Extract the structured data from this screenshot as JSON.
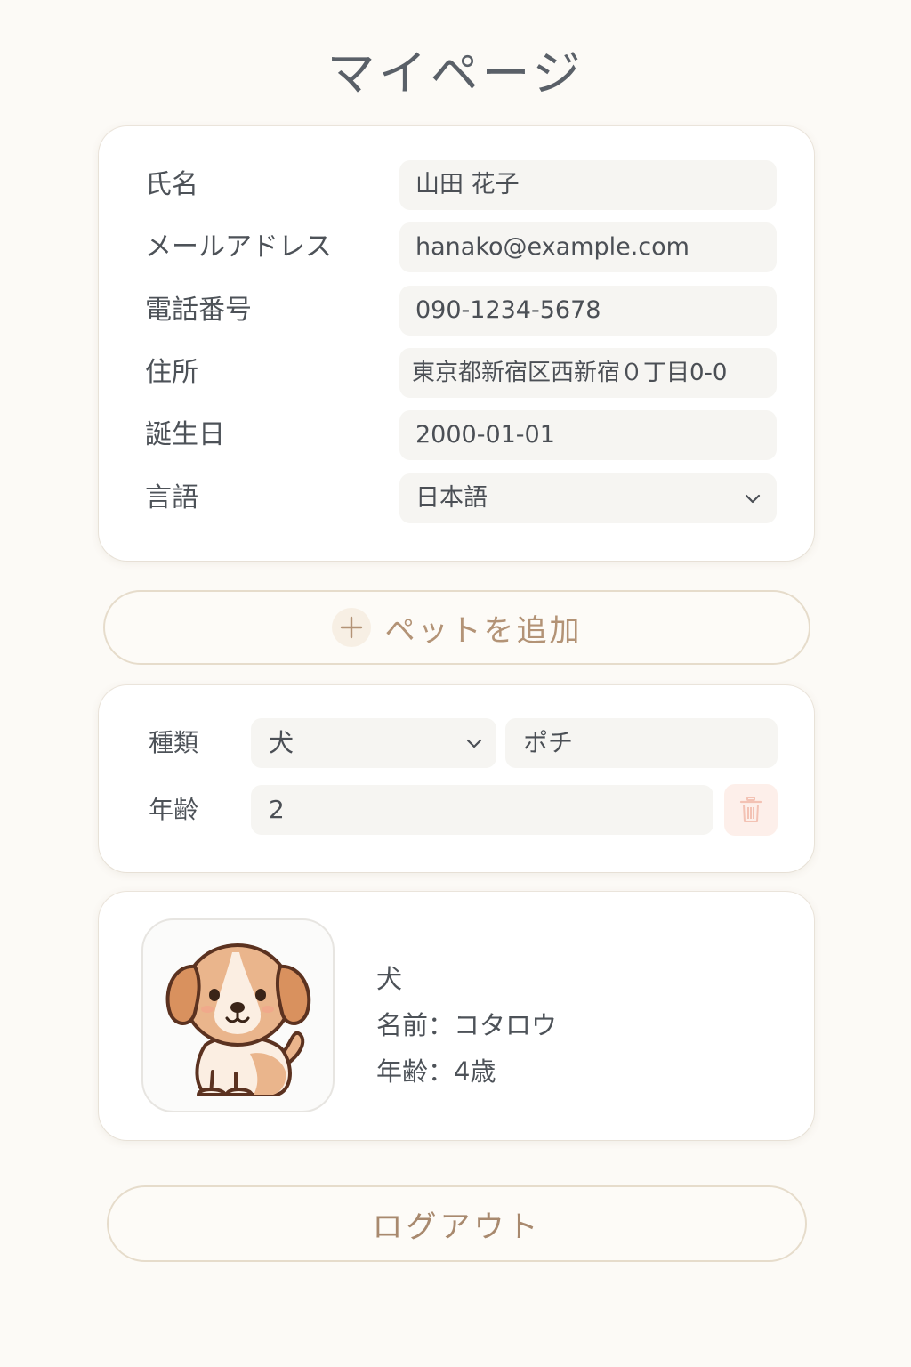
{
  "page": {
    "title": "マイページ"
  },
  "profile": {
    "fields": [
      {
        "label": "氏名",
        "value": "山田 花子"
      },
      {
        "label": "メールアドレス",
        "value": "hanako@example.com"
      },
      {
        "label": "電話番号",
        "value": "090-1234-5678"
      },
      {
        "label": "住所",
        "value": "東京都新宿区西新宿０丁目0-0"
      },
      {
        "label": "誕生日",
        "value": "2000-01-01"
      },
      {
        "label": "言語",
        "value": "日本語",
        "type": "select"
      }
    ]
  },
  "add_pet": {
    "label": "ペットを追加",
    "icon": "plus-icon"
  },
  "pet_form": {
    "type_label": "種類",
    "type_value": "犬",
    "name_value": "ポチ",
    "age_label": "年齢",
    "age_value": "2",
    "delete_icon": "trash-icon"
  },
  "pet_card": {
    "type": "犬",
    "name_line": "名前：コタロウ",
    "age_line": "年齢：4歳",
    "image": "dog-illustration"
  },
  "logout": {
    "label": "ログアウト"
  },
  "colors": {
    "background": "#fcfaf6",
    "card": "#ffffff",
    "field": "#f6f5f2",
    "accent": "#b39376",
    "border": "#e6dccb",
    "danger_bg": "#fdefea"
  }
}
